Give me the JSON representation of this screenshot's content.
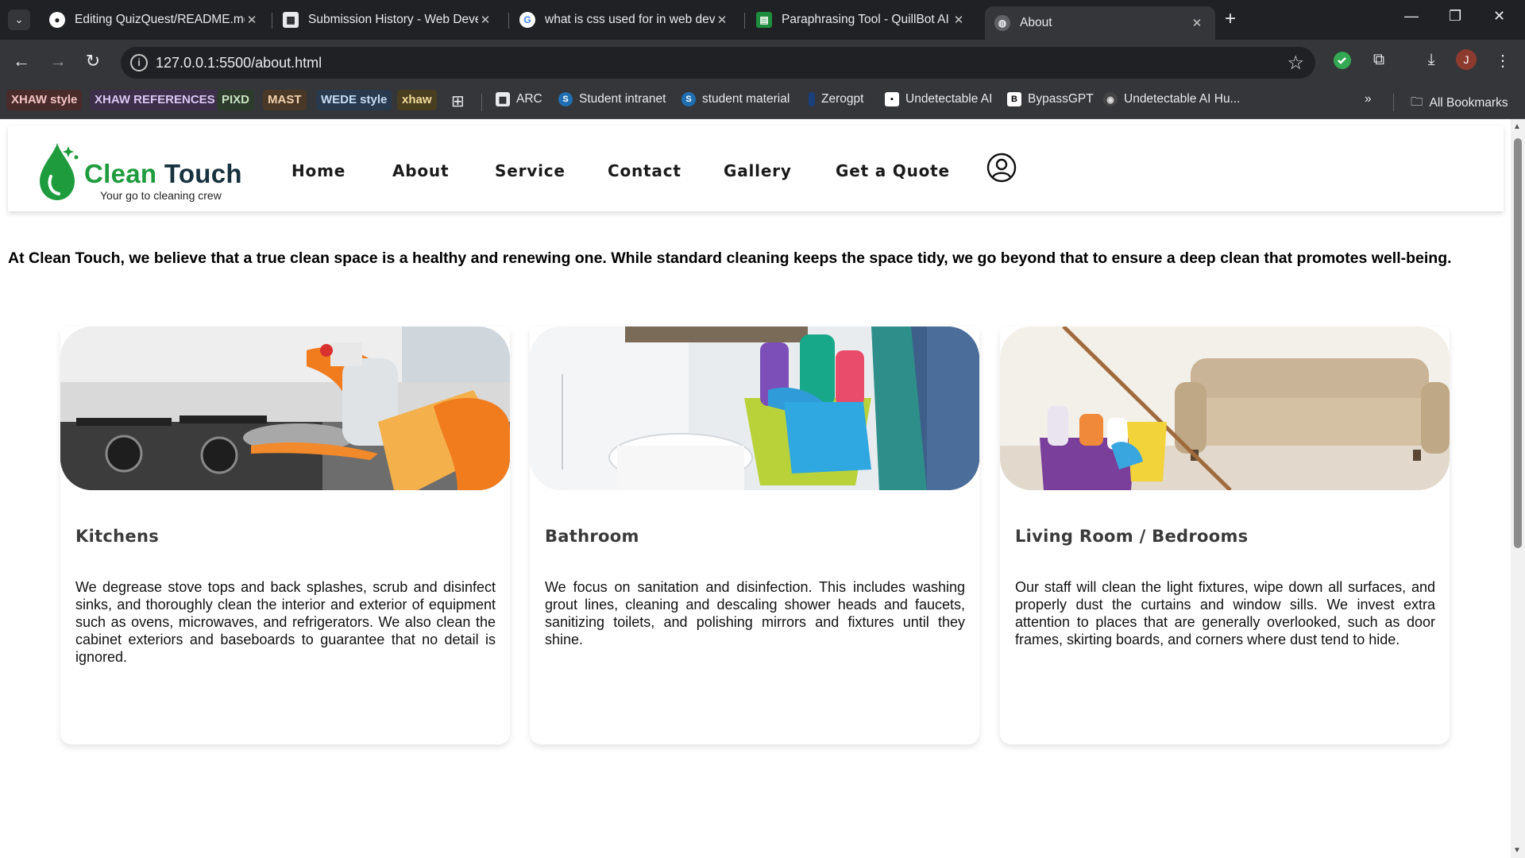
{
  "browser": {
    "tabs": [
      {
        "title": "Editing QuizQuest/README.md",
        "active": false
      },
      {
        "title": "Submission History - Web Deve",
        "active": false
      },
      {
        "title": "what is css used for in web deve",
        "active": false
      },
      {
        "title": "Paraphrasing Tool - QuillBot AI",
        "active": false
      },
      {
        "title": "About",
        "active": true
      }
    ],
    "url": "127.0.0.1:5500/about.html",
    "profile_initial": "J",
    "bookmark_chips": [
      {
        "label": "XHAW style",
        "bg": "#4a2b2b",
        "fg": "#f3c4c4"
      },
      {
        "label": "XHAW REFERENCES",
        "bg": "#3d2f4a",
        "fg": "#dcc7f2"
      },
      {
        "label": "PIXD",
        "bg": "#2d3b2c",
        "fg": "#c7e4c2"
      },
      {
        "label": "MAST",
        "bg": "#4a3826",
        "fg": "#f2d3ae"
      },
      {
        "label": "WEDE style",
        "bg": "#2a3a4e",
        "fg": "#c5dcf5"
      },
      {
        "label": "xhaw",
        "bg": "#4a3e20",
        "fg": "#f1dc9c"
      }
    ],
    "bookmarks": [
      {
        "label": "ARC"
      },
      {
        "label": "Student intranet"
      },
      {
        "label": "student material"
      },
      {
        "label": "Zerogpt"
      },
      {
        "label": "Undetectable AI"
      },
      {
        "label": "BypassGPT"
      },
      {
        "label": "Undetectable AI Hu..."
      }
    ],
    "all_bookmarks": "All Bookmarks"
  },
  "site": {
    "logo": {
      "name_part1": "Clean",
      "name_part2": "Touch",
      "tagline": "Your go to cleaning crew"
    },
    "nav": [
      "Home",
      "About",
      "Service",
      "Contact",
      "Gallery",
      "Get a Quote"
    ],
    "intro": "At Clean Touch, we believe that a true clean space is a healthy and renewing one. While standard cleaning keeps the space tidy, we go beyond that to ensure a deep clean that promotes well-being.",
    "cards": [
      {
        "title": "Kitchens",
        "text": "We degrease stove tops and back splashes, scrub and disinfect sinks, and thoroughly clean the interior and exterior of equipment such as ovens, microwaves, and refrigerators. We also clean the cabinet exteriors and baseboards to guarantee that no detail is ignored."
      },
      {
        "title": "Bathroom",
        "text": "We focus on sanitation and disinfection. This includes washing grout lines, cleaning and descaling shower heads and faucets, sanitizing toilets, and polishing mirrors and fixtures until they shine."
      },
      {
        "title": "Living Room / Bedrooms",
        "text": "Our staff will clean the light fixtures, wipe down all surfaces, and properly dust the curtains and window sills. We invest extra attention to places that are generally overlooked, such as door frames, skirting boards, and corners where dust tend to hide."
      }
    ]
  }
}
